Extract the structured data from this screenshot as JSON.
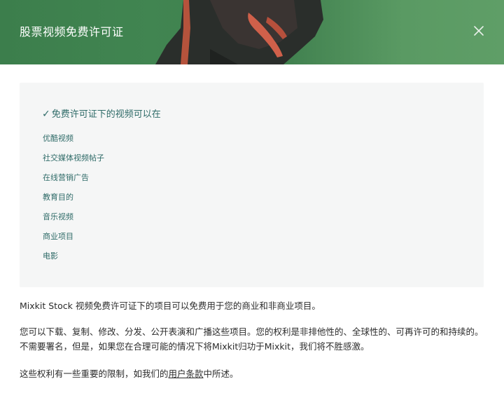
{
  "header": {
    "title": "股票视频免费许可证",
    "close_icon": "close-icon",
    "colors": {
      "background": "#418551",
      "accent": "#c4583e"
    }
  },
  "license_panel": {
    "check_icon": "✓",
    "heading": "免费许可证下的视频可以在",
    "items": [
      "优酷视频",
      "社交媒体视频帖子",
      "在线营销广告",
      "教育目的",
      "音乐视频",
      "商业项目",
      "电影"
    ],
    "text_color": "#2f6b68"
  },
  "description": {
    "brand": "Mixkit Stock",
    "line1_rest": " 视频免费许可证下的项目可以免费用于您的商业和非商业项目。",
    "paragraph2": "您可以下载、复制、修改、分发、公开表演和广播这些项目。您的权利是非排他性的、全球性的、可再许可的和持续的。不需要署名，但是，如果您在合理可能的情况下将Mixkit归功于Mixkit，我们将不胜感激。",
    "paragraph3_before": "这些权利有一些重要的限制，如我们的",
    "terms_link": "用户条款",
    "paragraph3_after": "中所述。"
  }
}
